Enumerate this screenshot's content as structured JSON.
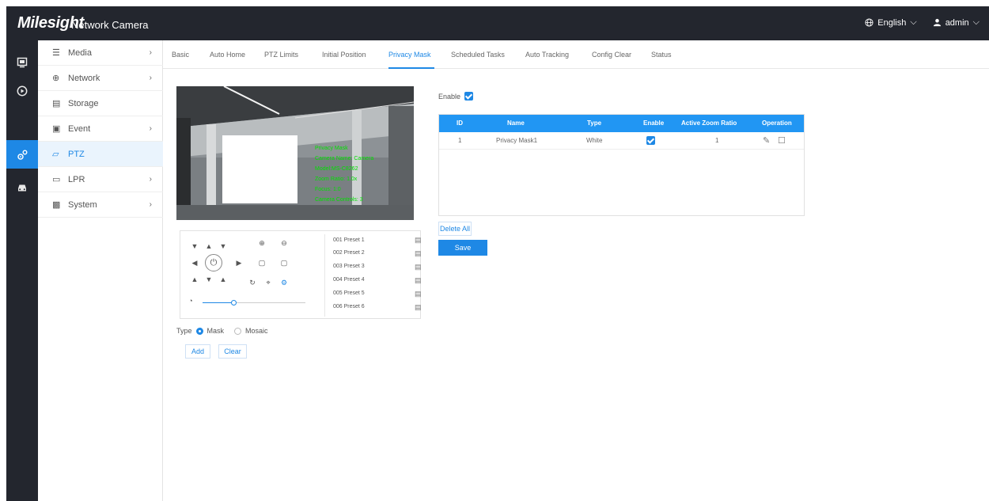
{
  "header": {
    "brand": "Milesight",
    "product": "Network Camera",
    "language": "English",
    "user": "admin"
  },
  "rail": {
    "icons": [
      "monitor-icon",
      "playback-icon",
      "settings-icon",
      "car-icon"
    ]
  },
  "sidebar": {
    "items": [
      {
        "label": "Media",
        "icon": "media-icon",
        "has_children": true
      },
      {
        "label": "Network",
        "icon": "globe-icon",
        "has_children": true
      },
      {
        "label": "Storage",
        "icon": "storage-icon",
        "has_children": false
      },
      {
        "label": "Event",
        "icon": "event-icon",
        "has_children": true
      },
      {
        "label": "PTZ",
        "icon": "ptz-icon",
        "has_children": false
      },
      {
        "label": "LPR",
        "icon": "car-icon",
        "has_children": true
      },
      {
        "label": "System",
        "icon": "system-icon",
        "has_children": true
      }
    ],
    "active": "PTZ"
  },
  "tabs": [
    {
      "label": "Basic"
    },
    {
      "label": "Auto Home"
    },
    {
      "label": "PTZ Limits"
    },
    {
      "label": "Initial Position"
    },
    {
      "label": "Privacy Mask"
    },
    {
      "label": "Scheduled Tasks"
    },
    {
      "label": "Auto Tracking"
    },
    {
      "label": "Config Clear"
    },
    {
      "label": "Status"
    }
  ],
  "active_tab": "Privacy Mask",
  "osd": {
    "lines": [
      "Privacy Mask",
      "Camera Name: Camera",
      "Model:MS-C8262",
      "Zoom Ratio: 1.0x",
      "Focus: 1:0",
      "Camera Controls: 3"
    ]
  },
  "presets": [
    {
      "label": "001  Preset 1"
    },
    {
      "label": "002  Preset 2"
    },
    {
      "label": "003  Preset 3"
    },
    {
      "label": "004  Preset 4"
    },
    {
      "label": "005  Preset 5"
    },
    {
      "label": "006  Preset 6"
    }
  ],
  "zoom": {
    "level": 0.3
  },
  "type_row": {
    "label": "Type",
    "options": [
      "Mask",
      "Mosaic"
    ],
    "selected": "Mask"
  },
  "buttons": {
    "add": "Add",
    "clear": "Clear",
    "delete_all": "Delete All",
    "save": "Save"
  },
  "enable": {
    "label": "Enable",
    "checked": true
  },
  "table": {
    "headers": [
      "ID",
      "Name",
      "Type",
      "Enable",
      "Active Zoom Ratio",
      "Operation"
    ],
    "rows": [
      {
        "id": "1",
        "name": "Privacy Mask1",
        "type": "White",
        "enable": true,
        "zoom": "1"
      }
    ]
  },
  "colors": {
    "accent": "#1e88e5",
    "topbar": "#23262e",
    "osd_text": "#00e000"
  }
}
